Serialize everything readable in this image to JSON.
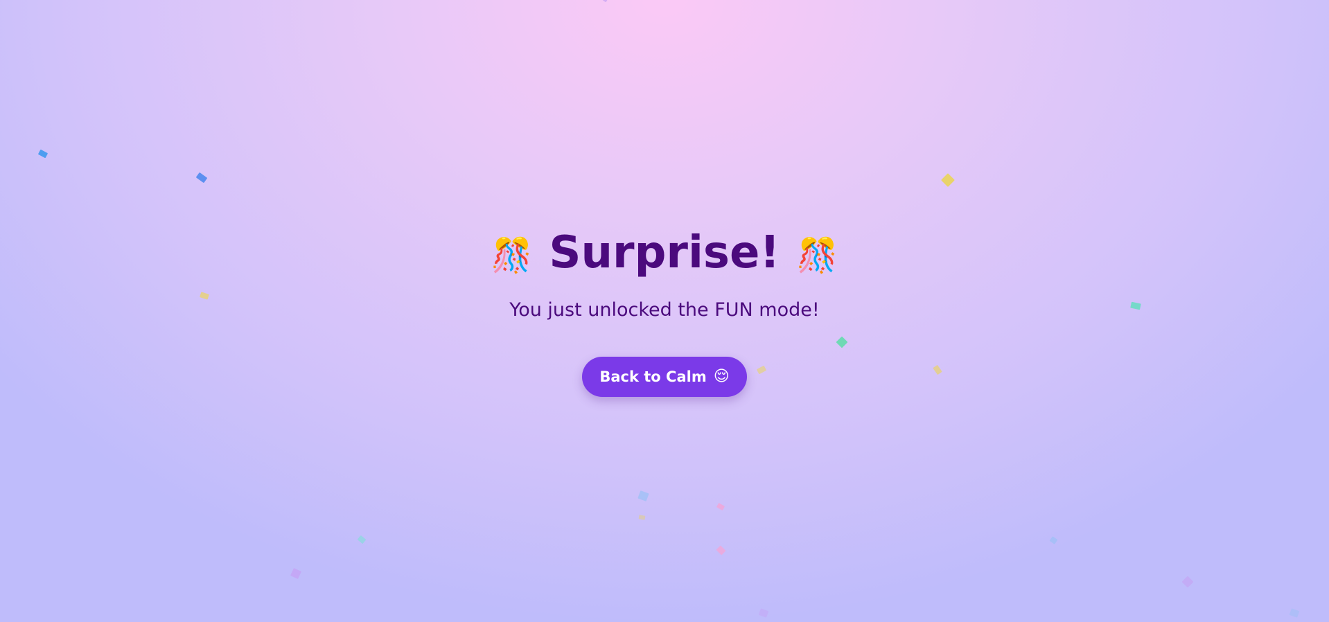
{
  "hero": {
    "title": "Surprise!",
    "title_icon_left": "party-popper-icon",
    "title_icon_right": "party-popper-icon",
    "title_emoji": "🎊",
    "subtitle": "You just unlocked the FUN mode!"
  },
  "actions": {
    "back_button_label": "Back to Calm",
    "back_button_emoji": "😌",
    "back_button_icon": "relieved-face-icon"
  },
  "theme": {
    "title_color": "#4b0a7d",
    "button_color": "#7b3ae8",
    "confetti_colors": [
      "#5aa7f0",
      "#e9d36a",
      "#75d9c9",
      "#c6a2f4",
      "#f1a6d8",
      "#7ee0d8",
      "#9ac0f5"
    ]
  }
}
